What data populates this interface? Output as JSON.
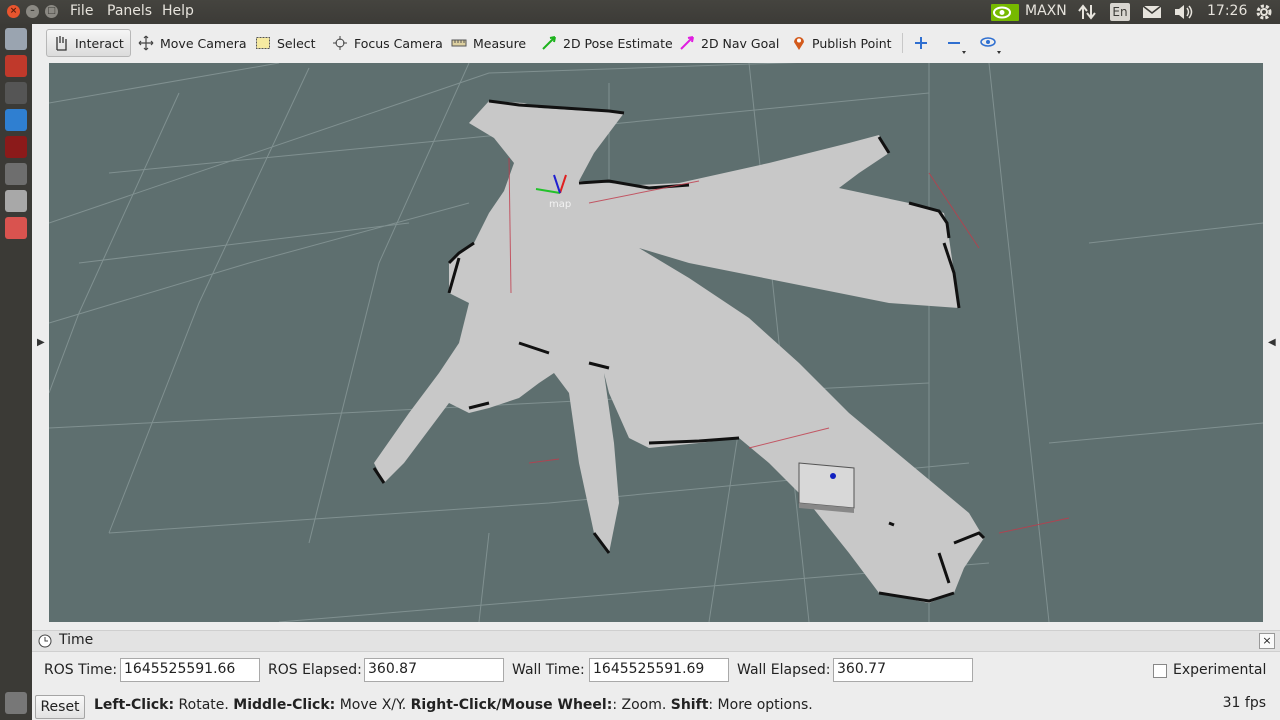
{
  "menubar": {
    "items": [
      "File",
      "Panels",
      "Help"
    ],
    "tray": {
      "power_mode": "MAXN",
      "language": "En",
      "clock": "17:26"
    }
  },
  "toolbar": {
    "tools": [
      {
        "label": "Interact",
        "icon": "hand-icon",
        "active": true
      },
      {
        "label": "Move Camera",
        "icon": "move-camera-icon"
      },
      {
        "label": "Select",
        "icon": "select-box-icon"
      },
      {
        "label": "Focus Camera",
        "icon": "focus-camera-icon"
      },
      {
        "label": "Measure",
        "icon": "ruler-icon"
      },
      {
        "label": "2D Pose Estimate",
        "icon": "green-arrow-icon"
      },
      {
        "label": "2D Nav Goal",
        "icon": "magenta-arrow-icon"
      },
      {
        "label": "Publish Point",
        "icon": "map-pin-icon"
      }
    ]
  },
  "viewport": {
    "frame_label": "map"
  },
  "time_panel": {
    "title": "Time",
    "ros_time_label": "ROS Time:",
    "ros_time": "1645525591.66",
    "ros_elapsed_label": "ROS Elapsed:",
    "ros_elapsed": "360.87",
    "wall_time_label": "Wall Time:",
    "wall_time": "1645525591.69",
    "wall_elapsed_label": "Wall Elapsed:",
    "wall_elapsed": "360.77",
    "experimental_label": "Experimental"
  },
  "statusbar": {
    "reset_label": "Reset",
    "hint_left_click_key": "Left-Click:",
    "hint_left_click_val": " Rotate. ",
    "hint_middle_click_key": "Middle-Click:",
    "hint_middle_click_val": " Move X/Y. ",
    "hint_right_click_key": "Right-Click/Mouse Wheel:",
    "hint_right_click_val": ": Zoom. ",
    "hint_shift_key": "Shift",
    "hint_shift_val": ": More options.",
    "fps": "31 fps"
  },
  "colors": {
    "viewport_bg": "#5e6f6f",
    "grid": "#8c9c9c",
    "free_space": "#c8c8c8",
    "obstacles": "#111111",
    "menubar_bg": "#3c3b37",
    "launcher_bg": "#3b3a36"
  }
}
